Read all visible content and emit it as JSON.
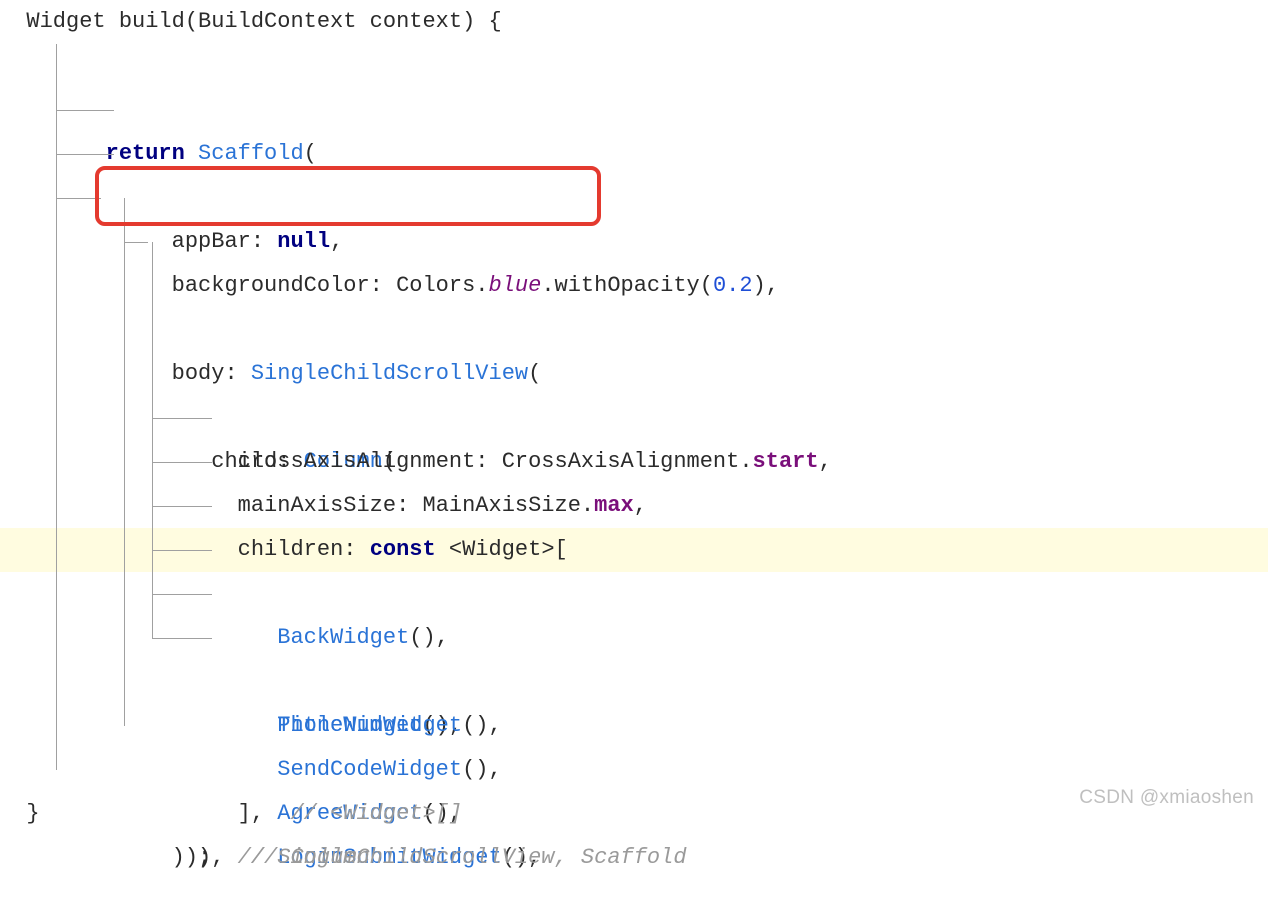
{
  "code": {
    "l1": "  Widget build(BuildContext context) {",
    "l2_return": "return",
    "l2_class": "Scaffold",
    "l2_tail": "(",
    "l3_head": "appBar: ",
    "l3_null": "null",
    "l3_tail": ",",
    "l4_head": "backgroundColor: Colors.",
    "l4_blue": "blue",
    "l4_mid": ".withOpacity(",
    "l4_num": "0.2",
    "l4_tail": "),",
    "l5_head": "body: ",
    "l5_class": "SingleChildScrollView",
    "l5_tail": "(",
    "l6_head": "child: ",
    "l6_class": "Column",
    "l6_tail": "(",
    "l7_head": "crossAxisAlignment: CrossAxisAlignment.",
    "l7_enum": "start",
    "l7_tail": ",",
    "l8_head": "mainAxisSize: MainAxisSize.",
    "l8_enum": "max",
    "l8_tail": ",",
    "l9_head": "children: ",
    "l9_const": "const",
    "l9_tail": " <Widget>[",
    "l10_class": "BackWidget",
    "l10_tail": "(),",
    "l11_class": "TitleWidget",
    "l11_tail": "(),",
    "l12_class": "PhoneNumWidget",
    "l12_tail": "(),",
    "l13_class": "SendCodeWidget",
    "l13_tail": "(),",
    "l14_class": "AgreeWidget",
    "l14_tail": "(),",
    "l15_class": "LoginSubmitWidget",
    "l15_tail": "(),",
    "l16": "],  ",
    "l16_comment": "// <Widget>[]",
    "l17": "),  ",
    "l17_comment": "// Column",
    "l18": "));  ",
    "l18_comment": "// SingleChildScrollView, Scaffold",
    "l19": "  }"
  },
  "watermark": "CSDN @xmiaoshen"
}
